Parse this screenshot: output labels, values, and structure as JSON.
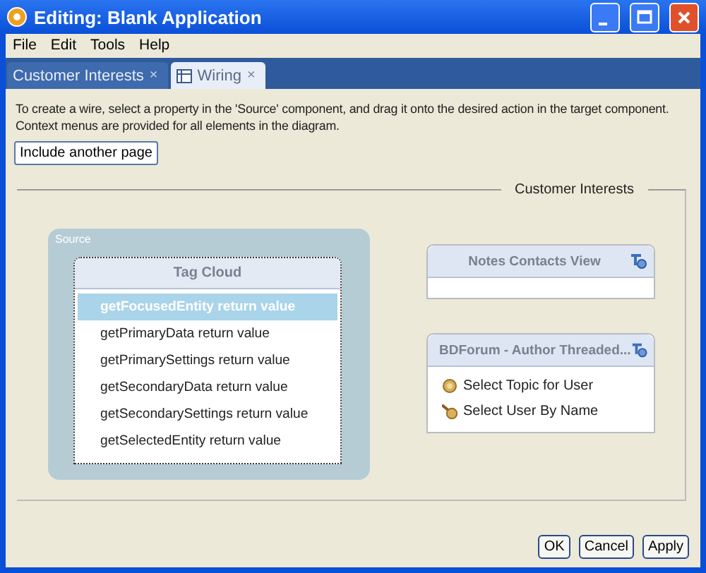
{
  "window": {
    "title": "Editing: Blank Application"
  },
  "menu": [
    "File",
    "Edit",
    "Tools",
    "Help"
  ],
  "tabs": [
    {
      "label": "Customer Interests",
      "close": "×",
      "selected": false
    },
    {
      "label": "Wiring",
      "close": "×",
      "selected": true
    }
  ],
  "instructions": [
    "To create a wire, select a property in the 'Source' component, and drag it onto the desired action in the target component.",
    "Context menus are provided for all elements in the diagram."
  ],
  "include_button": "Include another page",
  "page_group": {
    "legend": "Customer Interests",
    "source": {
      "label": "Source",
      "component": {
        "title": "Tag Cloud",
        "properties": [
          {
            "label": "getFocusedEntity return value",
            "selected": true
          },
          {
            "label": "getPrimaryData return value",
            "selected": false
          },
          {
            "label": "getPrimarySettings return value",
            "selected": false
          },
          {
            "label": "getSecondaryData return value",
            "selected": false
          },
          {
            "label": "getSecondarySettings return value",
            "selected": false
          },
          {
            "label": "getSelectedEntity return value",
            "selected": false
          }
        ]
      }
    },
    "targets": [
      {
        "title": "Notes Contacts View"
      },
      {
        "title": "BDForum - Author Threaded...",
        "actions": [
          {
            "label": "Select Topic for User",
            "kind": "round"
          },
          {
            "label": "Select User By Name",
            "kind": "hand"
          }
        ]
      }
    ]
  },
  "buttons": [
    "OK",
    "Cancel",
    "Apply"
  ]
}
